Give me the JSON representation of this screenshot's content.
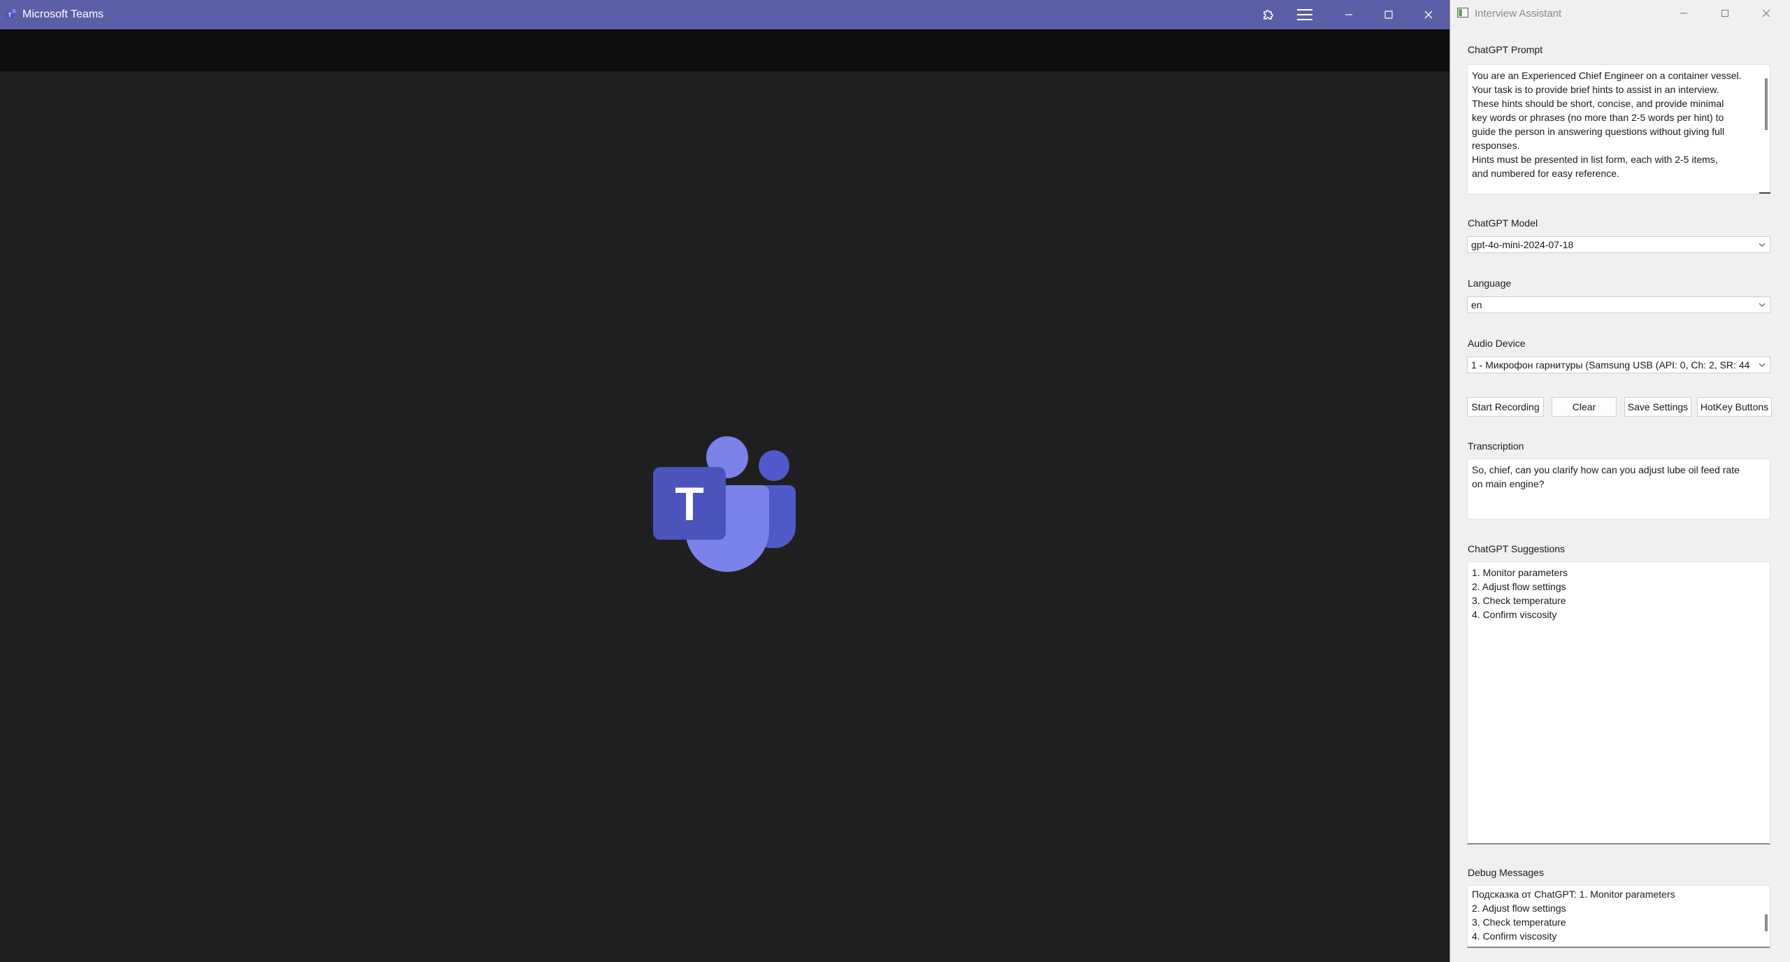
{
  "teams": {
    "title": "Microsoft Teams",
    "logo_letter": "T",
    "colors": {
      "titlebar": "#5b5fa7",
      "background": "#1f1f1f",
      "brand": "#5059c9"
    }
  },
  "assistant": {
    "title": "Interview Assistant",
    "prompt": {
      "label": "ChatGPT Prompt",
      "value": "You are an Experienced Chief Engineer on a container vessel.\nYour task is to provide brief hints to assist in an interview.\nThese hints should be short, concise, and provide minimal\nkey words or phrases (no more than 2-5 words per hint) to\nguide the person in answering questions without giving full\nresponses.\nHints must be presented in list form, each with 2-5 items,\nand numbered for easy reference."
    },
    "model": {
      "label": "ChatGPT Model",
      "value": "gpt-4o-mini-2024-07-18"
    },
    "language": {
      "label": "Language",
      "value": "en"
    },
    "audio_device": {
      "label": "Audio Device",
      "value": "1 - Микрофон гарнитуры (Samsung USB (API: 0, Ch: 2, SR: 44"
    },
    "buttons": {
      "start_recording": "Start Recording",
      "clear": "Clear",
      "save_settings": "Save Settings",
      "hotkey_buttons": "HotKey Buttons"
    },
    "transcription": {
      "label": "Transcription",
      "value": "So, chief, can you clarify how can you adjust lube oil feed rate\non main engine?"
    },
    "suggestions": {
      "label": "ChatGPT Suggestions",
      "value": "1. Monitor parameters\n2. Adjust flow settings\n3. Check temperature\n4. Confirm viscosity"
    },
    "debug": {
      "label": "Debug Messages",
      "value": "Подсказка от ChatGPT: 1. Monitor parameters\n2. Adjust flow settings\n3. Check temperature\n4. Confirm viscosity"
    }
  }
}
